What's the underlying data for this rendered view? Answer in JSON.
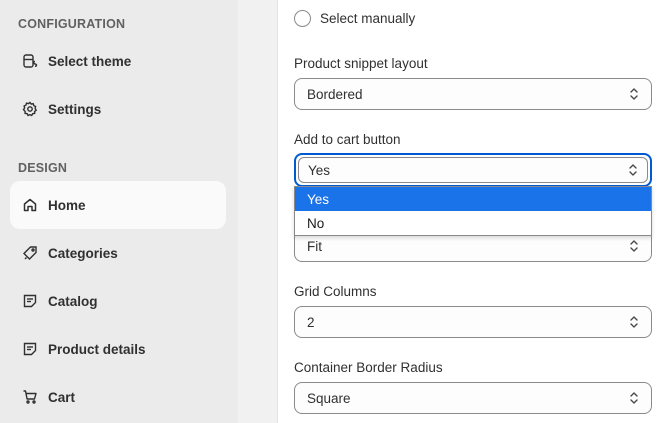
{
  "sidebar": {
    "configuration_title": "CONFIGURATION",
    "design_title": "DESIGN",
    "config_items": [
      {
        "label": "Select theme",
        "icon": "theme-icon"
      },
      {
        "label": "Settings",
        "icon": "gear-icon"
      }
    ],
    "design_items": [
      {
        "label": "Home",
        "icon": "home-icon",
        "active": true
      },
      {
        "label": "Categories",
        "icon": "tag-icon"
      },
      {
        "label": "Catalog",
        "icon": "catalog-icon"
      },
      {
        "label": "Product details",
        "icon": "product-details-icon"
      },
      {
        "label": "Cart",
        "icon": "cart-icon"
      }
    ]
  },
  "main": {
    "select_manually_label": "Select manually",
    "fields": [
      {
        "label": "Product snippet layout",
        "value": "Bordered"
      },
      {
        "label": "Add to cart button",
        "value": "Yes"
      },
      {
        "label": "",
        "value": "Fit"
      },
      {
        "label": "Grid Columns",
        "value": "2"
      },
      {
        "label": "Container Border Radius",
        "value": "Square"
      }
    ],
    "dropdown_options": [
      "Yes",
      "No"
    ],
    "dropdown_selected": "Yes"
  },
  "colors": {
    "sidebar_bg": "#ebebeb",
    "focus_ring": "#005bd3",
    "option_highlight": "#1a73e8"
  }
}
